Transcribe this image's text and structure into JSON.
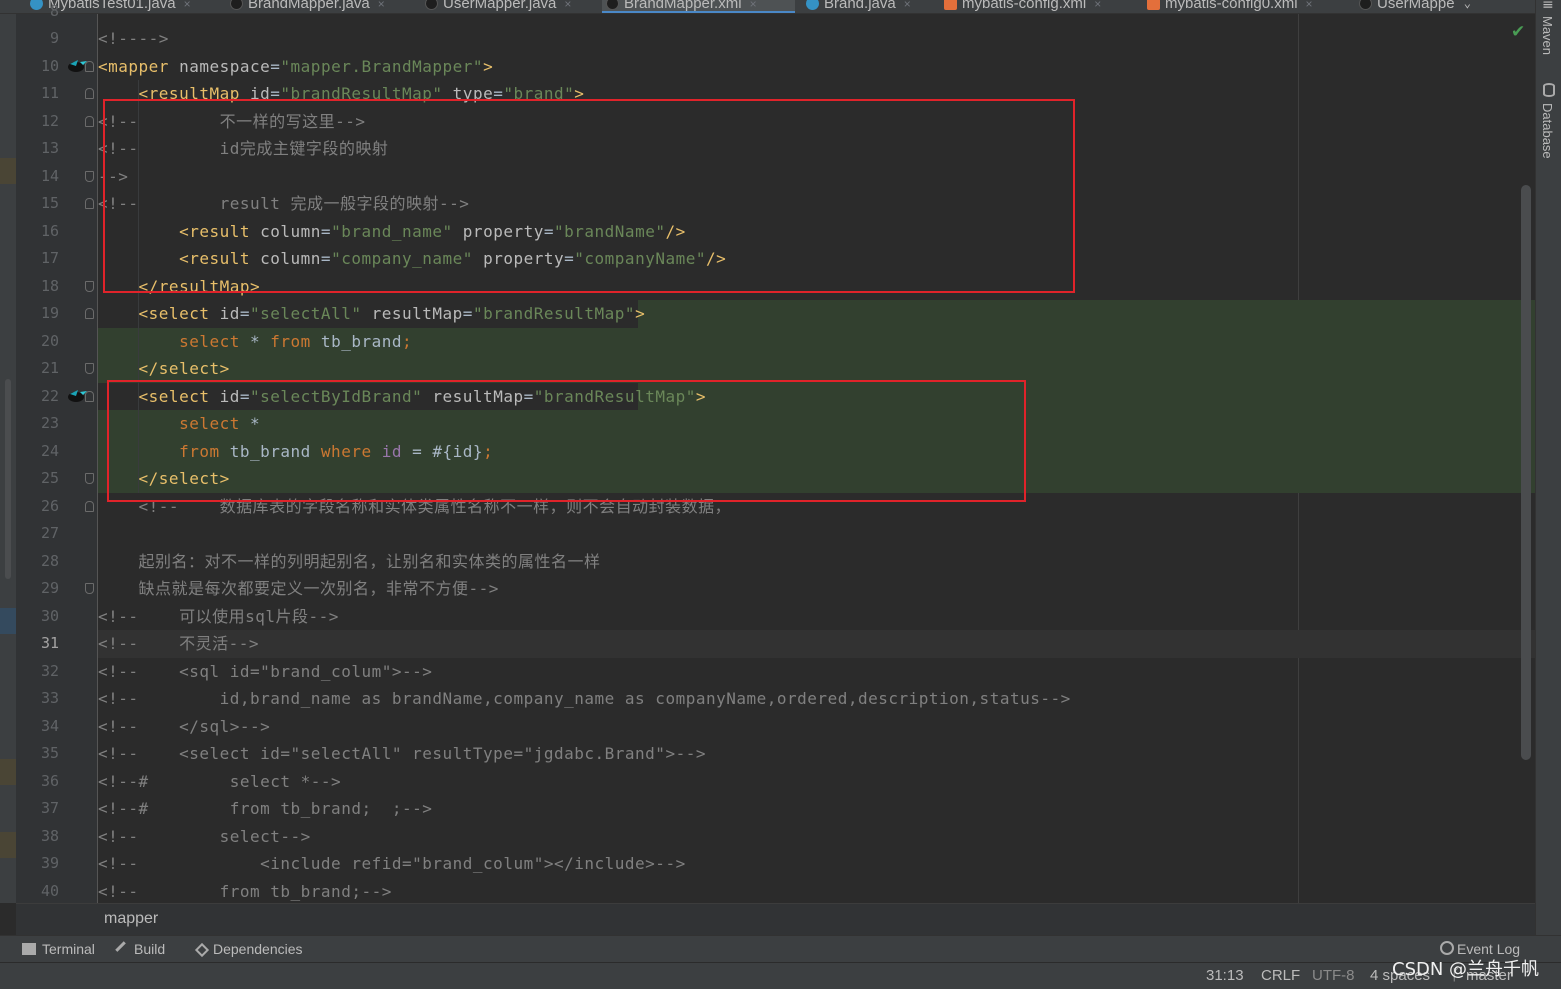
{
  "tabs": [
    {
      "label": "MybatisTest01.java",
      "icon": "java-class-icon",
      "active": false
    },
    {
      "label": "BrandMapper.java",
      "icon": "mapper-interface-icon",
      "active": false
    },
    {
      "label": "UserMapper.java",
      "icon": "mapper-interface-icon",
      "active": false
    },
    {
      "label": "BrandMapper.xml",
      "icon": "mybatis-xml-icon",
      "active": true
    },
    {
      "label": "Brand.java",
      "icon": "java-class-icon",
      "active": false
    },
    {
      "label": "mybatis-config.xml",
      "icon": "xml-file-icon",
      "active": false
    },
    {
      "label": "mybatis-config0.xml",
      "icon": "xml-file-icon",
      "active": false
    },
    {
      "label": "UserMappe",
      "icon": "mapper-interface-icon",
      "active": false
    }
  ],
  "tab_close_glyph": "×",
  "tab_dropdown_glyph": "⌄",
  "tab_menu_glyph": "≡",
  "inspection_glyph": "✔",
  "editor": {
    "top_partial_line": "8",
    "lines": [
      {
        "n": "9",
        "tokens": [
          {
            "t": "<!---->",
            "c": "com"
          }
        ]
      },
      {
        "n": "10",
        "tokens": [
          {
            "t": "<mapper ",
            "c": "tag"
          },
          {
            "t": "namespace",
            "c": "attr"
          },
          {
            "t": "=",
            "c": "txt"
          },
          {
            "t": "\"mapper.BrandMapper\"",
            "c": "val"
          },
          {
            "t": ">",
            "c": "tag"
          }
        ]
      },
      {
        "n": "11",
        "tokens": [
          {
            "t": "    <resultMap ",
            "c": "tag"
          },
          {
            "t": "id",
            "c": "attr"
          },
          {
            "t": "=",
            "c": "txt"
          },
          {
            "t": "\"brandResultMap\" ",
            "c": "val"
          },
          {
            "t": "type",
            "c": "attr"
          },
          {
            "t": "=",
            "c": "txt"
          },
          {
            "t": "\"brand\"",
            "c": "val"
          },
          {
            "t": ">",
            "c": "tag"
          }
        ]
      },
      {
        "n": "12",
        "tokens": [
          {
            "t": "<!--        不一样的写这里-->",
            "c": "com"
          }
        ]
      },
      {
        "n": "13",
        "tokens": [
          {
            "t": "<!--        id完成主键字段的映射",
            "c": "com"
          }
        ]
      },
      {
        "n": "14",
        "tokens": [
          {
            "t": "-->",
            "c": "com"
          }
        ]
      },
      {
        "n": "15",
        "tokens": [
          {
            "t": "<!--        result 完成一般字段的映射-->",
            "c": "com"
          }
        ]
      },
      {
        "n": "16",
        "tokens": [
          {
            "t": "        <result ",
            "c": "tag"
          },
          {
            "t": "column",
            "c": "attr"
          },
          {
            "t": "=",
            "c": "txt"
          },
          {
            "t": "\"brand_name\" ",
            "c": "val"
          },
          {
            "t": "property",
            "c": "attr"
          },
          {
            "t": "=",
            "c": "txt"
          },
          {
            "t": "\"brandName\"",
            "c": "val"
          },
          {
            "t": "/>",
            "c": "tag"
          }
        ]
      },
      {
        "n": "17",
        "tokens": [
          {
            "t": "        <result ",
            "c": "tag"
          },
          {
            "t": "column",
            "c": "attr"
          },
          {
            "t": "=",
            "c": "txt"
          },
          {
            "t": "\"company_name\" ",
            "c": "val"
          },
          {
            "t": "property",
            "c": "attr"
          },
          {
            "t": "=",
            "c": "txt"
          },
          {
            "t": "\"companyName\"",
            "c": "val"
          },
          {
            "t": "/>",
            "c": "tag"
          }
        ]
      },
      {
        "n": "18",
        "tokens": [
          {
            "t": "    </resultMap>",
            "c": "tag"
          }
        ]
      },
      {
        "n": "19",
        "tokens": [
          {
            "t": "    <select ",
            "c": "tag"
          },
          {
            "t": "id",
            "c": "attr"
          },
          {
            "t": "=",
            "c": "txt"
          },
          {
            "t": "\"selectAll\" ",
            "c": "val"
          },
          {
            "t": "resultMap",
            "c": "attr"
          },
          {
            "t": "=",
            "c": "txt"
          },
          {
            "t": "\"brandResultMap\"",
            "c": "val"
          },
          {
            "t": ">",
            "c": "tag"
          }
        ]
      },
      {
        "n": "20",
        "tokens": [
          {
            "t": "        ",
            "c": "txt"
          },
          {
            "t": "select",
            "c": "kw"
          },
          {
            "t": " * ",
            "c": "txt"
          },
          {
            "t": "from",
            "c": "kw"
          },
          {
            "t": " tb_brand",
            "c": "txt"
          },
          {
            "t": ";",
            "c": "kw"
          }
        ]
      },
      {
        "n": "21",
        "tokens": [
          {
            "t": "    </select>",
            "c": "tag"
          }
        ]
      },
      {
        "n": "22",
        "tokens": [
          {
            "t": "    <select ",
            "c": "tag"
          },
          {
            "t": "id",
            "c": "attr"
          },
          {
            "t": "=",
            "c": "txt"
          },
          {
            "t": "\"selectByIdBrand\" ",
            "c": "val"
          },
          {
            "t": "resultMap",
            "c": "attr"
          },
          {
            "t": "=",
            "c": "txt"
          },
          {
            "t": "\"brandResultMap\"",
            "c": "val"
          },
          {
            "t": ">",
            "c": "tag"
          }
        ]
      },
      {
        "n": "23",
        "tokens": [
          {
            "t": "        ",
            "c": "txt"
          },
          {
            "t": "select",
            "c": "kw"
          },
          {
            "t": " *",
            "c": "txt"
          }
        ]
      },
      {
        "n": "24",
        "tokens": [
          {
            "t": "        ",
            "c": "txt"
          },
          {
            "t": "from",
            "c": "kw"
          },
          {
            "t": " tb_brand ",
            "c": "txt"
          },
          {
            "t": "where",
            "c": "kw"
          },
          {
            "t": " ",
            "c": "txt"
          },
          {
            "t": "id",
            "c": "var"
          },
          {
            "t": " = #{id}",
            "c": "txt"
          },
          {
            "t": ";",
            "c": "kw"
          }
        ]
      },
      {
        "n": "25",
        "tokens": [
          {
            "t": "    </select>",
            "c": "tag"
          }
        ]
      },
      {
        "n": "26",
        "tokens": [
          {
            "t": "    <!--    数据库表的字段名称和实体类属性名称不一样，则不会自动封装数据，",
            "c": "com"
          }
        ]
      },
      {
        "n": "27",
        "tokens": []
      },
      {
        "n": "28",
        "tokens": [
          {
            "t": "    起别名：对不一样的列明起别名，让别名和实体类的属性名一样",
            "c": "com"
          }
        ]
      },
      {
        "n": "29",
        "tokens": [
          {
            "t": "    缺点就是每次都要定义一次别名，非常不方便-->",
            "c": "com"
          }
        ]
      },
      {
        "n": "30",
        "tokens": [
          {
            "t": "<!--    可以使用sql片段-->",
            "c": "com"
          }
        ]
      },
      {
        "n": "31",
        "tokens": [
          {
            "t": "<!--    不灵活-->",
            "c": "com"
          }
        ]
      },
      {
        "n": "32",
        "tokens": [
          {
            "t": "<!--    <sql id=\"brand_colum\">-->",
            "c": "com"
          }
        ]
      },
      {
        "n": "33",
        "tokens": [
          {
            "t": "<!--        id,brand_name as brandName,company_name as companyName,ordered,description,status-->",
            "c": "com"
          }
        ]
      },
      {
        "n": "34",
        "tokens": [
          {
            "t": "<!--    </sql>-->",
            "c": "com"
          }
        ]
      },
      {
        "n": "35",
        "tokens": [
          {
            "t": "<!--    <select id=\"selectAll\" resultType=\"jgdabc.Brand\">-->",
            "c": "com"
          }
        ]
      },
      {
        "n": "36",
        "tokens": [
          {
            "t": "<!--#        select *-->",
            "c": "com"
          }
        ]
      },
      {
        "n": "37",
        "tokens": [
          {
            "t": "<!--#        from tb_brand;  ;-->",
            "c": "com"
          }
        ]
      },
      {
        "n": "38",
        "tokens": [
          {
            "t": "<!--        select-->",
            "c": "com"
          }
        ]
      },
      {
        "n": "39",
        "tokens": [
          {
            "t": "<!--            <include refid=\"brand_colum\"></include>-->",
            "c": "com"
          }
        ]
      },
      {
        "n": "40",
        "tokens": [
          {
            "t": "<!--        from tb_brand;-->",
            "c": "com"
          }
        ]
      }
    ]
  },
  "breadcrumb": "mapper",
  "right_tools": {
    "maven": "Maven",
    "database": "Database"
  },
  "bottom_tools": {
    "terminal": "Terminal",
    "build": "Build",
    "dependencies": "Dependencies",
    "event_log": "Event Log"
  },
  "status": {
    "position": "31:13",
    "line_separator": "CRLF",
    "encoding": "UTF-8",
    "indent": "4 spaces",
    "branch": "master"
  },
  "watermark": "CSDN @兰舟千帆",
  "colors": {
    "tag": "#e8bf6a",
    "attr": "#bababa",
    "val": "#6a8759",
    "com": "#808080",
    "kw": "#cc7832",
    "txt": "#a9b7c6",
    "var": "#9876aa",
    "annotation_box": "#e0232a"
  }
}
